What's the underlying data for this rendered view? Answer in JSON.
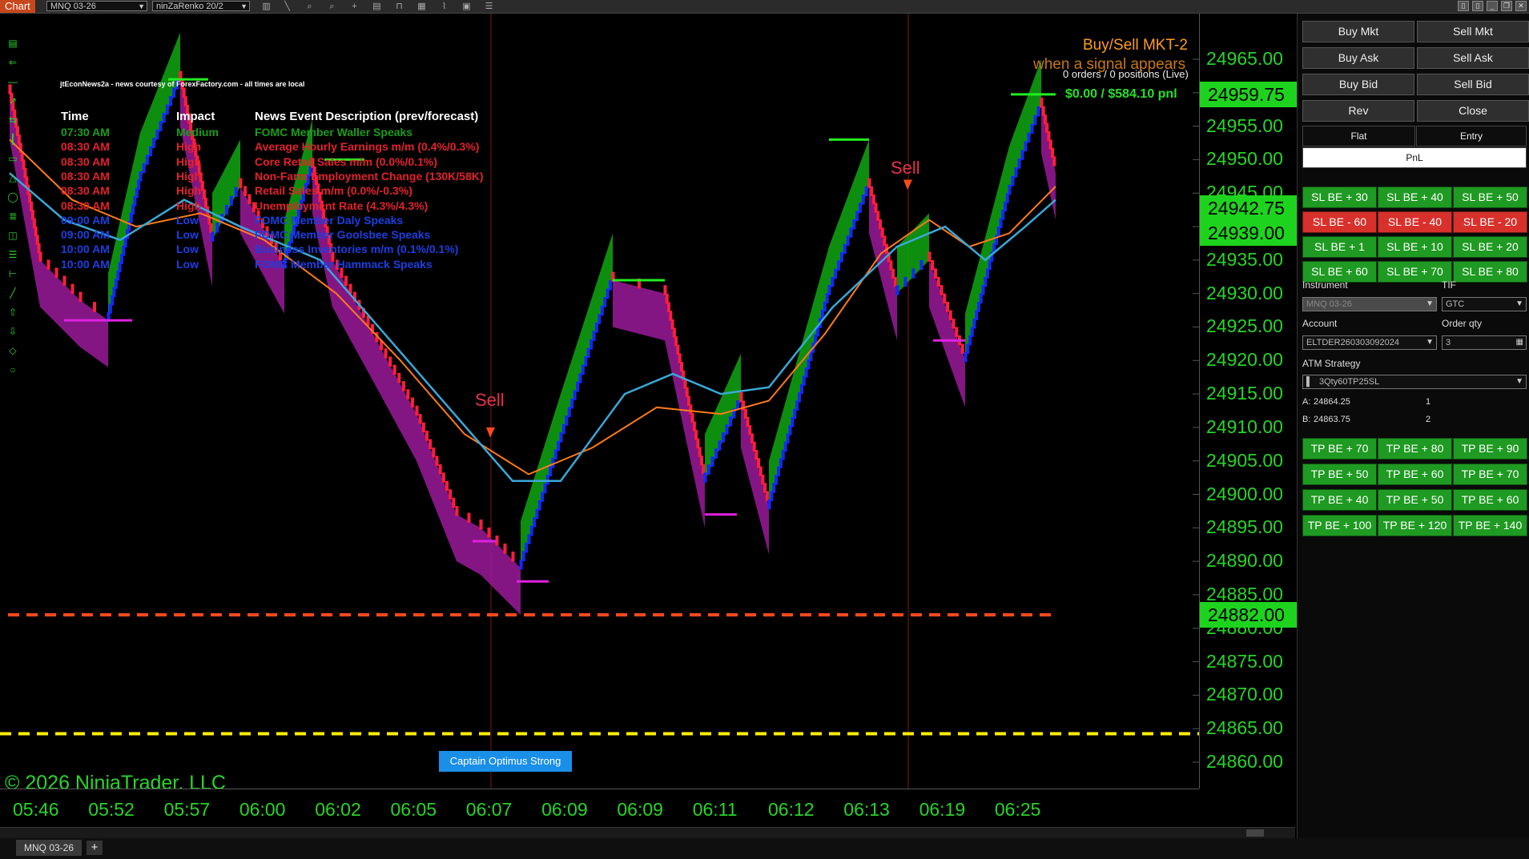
{
  "toolbar": {
    "app_label": "Chart",
    "instrument": "MNQ 03-26",
    "bar_type": "ninZaRenko 20/2"
  },
  "chart": {
    "news": {
      "source": "jtEconNews2a - news courtesy of ForexFactory.com - all times are local",
      "headers": {
        "time": "Time",
        "impact": "Impact",
        "description": "News Event Description (prev/forecast)"
      },
      "rows": [
        {
          "time": "07:30 AM",
          "impact": "Medium",
          "description": "FOMC Member Waller Speaks",
          "color": "#1b9d1b"
        },
        {
          "time": "08:30 AM",
          "impact": "High",
          "description": "Average Hourly Earnings m/m (0.4%/0.3%)",
          "color": "#e3222a"
        },
        {
          "time": "08:30 AM",
          "impact": "High",
          "description": "Core Retail Sales m/m (0.0%/0.1%)",
          "color": "#e3222a"
        },
        {
          "time": "08:30 AM",
          "impact": "High",
          "description": "Non-Farm Employment Change (130K/58K)",
          "color": "#e3222a"
        },
        {
          "time": "08:30 AM",
          "impact": "High",
          "description": "Retail Sales m/m (0.0%/-0.3%)",
          "color": "#e3222a"
        },
        {
          "time": "08:30 AM",
          "impact": "High",
          "description": "Unemployment Rate (4.3%/4.3%)",
          "color": "#e3222a"
        },
        {
          "time": "09:00 AM",
          "impact": "Low",
          "description": "FOMC Member Daly Speaks",
          "color": "#1c3fe0"
        },
        {
          "time": "09:00 AM",
          "impact": "Low",
          "description": "FOMC Member Goolsbee Speaks",
          "color": "#1c3fe0"
        },
        {
          "time": "10:00 AM",
          "impact": "Low",
          "description": "Business Inventories m/m (0.1%/0.1%)",
          "color": "#1c3fe0"
        },
        {
          "time": "10:00 AM",
          "impact": "Low",
          "description": "FOMC Member Hammack Speaks",
          "color": "#1c3fe0"
        }
      ]
    },
    "buy_sell": {
      "title": "Buy/Sell MKT-2",
      "subtitle": "when a signal appears",
      "orders": "0 orders / 0 positions (Live)",
      "pnl": "$0.00 / $584.10 pnl"
    },
    "sell_labels": [
      "Sell",
      "Sell"
    ],
    "captain_button": "Captain Optimus Strong",
    "copyright": "© 2026 NinjaTrader, LLC",
    "price_ticks": [
      "24965.00",
      "24960.00",
      "24955.00",
      "24950.00",
      "24945.00",
      "24940.00",
      "24935.00",
      "24930.00",
      "24925.00",
      "24920.00",
      "24915.00",
      "24910.00",
      "24905.00",
      "24900.00",
      "24895.00",
      "24890.00",
      "24885.00",
      "24880.00",
      "24875.00",
      "24870.00",
      "24865.00",
      "24860.00"
    ],
    "price_tags": [
      {
        "label": "24959.75",
        "price": 24959.75
      },
      {
        "label": "24942.75",
        "price": 24942.75
      },
      {
        "label": "24939.00",
        "price": 24939.0
      },
      {
        "label": "24882.00",
        "price": 24882.0
      }
    ],
    "time_ticks": [
      "05:46",
      "05:52",
      "05:57",
      "06:00",
      "06:02",
      "06:05",
      "06:07",
      "06:09",
      "06:09",
      "06:11",
      "06:12",
      "06:13",
      "06:19",
      "06:25"
    ],
    "colors": {
      "axis_green": "#27d427",
      "up_brick": "#1428ff",
      "down_brick": "#ff1e3c",
      "channel_green": "#11a711",
      "channel_purple": "#9a1a9a",
      "orange_line": "#ff4a1a",
      "yellow_line": "#ffee00"
    },
    "levels": {
      "orange_dashed": 24882.0,
      "yellow_dashed": 24864.25
    }
  },
  "bottom": {
    "tab": "MNQ 03-26",
    "add_tab": "+"
  },
  "panel": {
    "order_buttons": [
      [
        "Buy Mkt",
        "Sell Mkt"
      ],
      [
        "Buy Ask",
        "Sell Ask"
      ],
      [
        "Buy Bid",
        "Sell Bid"
      ],
      [
        "Rev",
        "Close"
      ]
    ],
    "tabs": [
      "Flat",
      "Entry"
    ],
    "pnl_tab": "PnL",
    "sl_rows": [
      [
        {
          "label": "SL BE + 30",
          "kind": "green"
        },
        {
          "label": "SL BE + 40",
          "kind": "green"
        },
        {
          "label": "SL BE + 50",
          "kind": "green"
        }
      ],
      [
        {
          "label": "SL BE - 60",
          "kind": "red"
        },
        {
          "label": "SL BE - 40",
          "kind": "red"
        },
        {
          "label": "SL BE - 20",
          "kind": "red"
        }
      ],
      [
        {
          "label": "SL BE + 1",
          "kind": "green"
        },
        {
          "label": "SL BE + 10",
          "kind": "green"
        },
        {
          "label": "SL BE + 20",
          "kind": "green"
        }
      ],
      [
        {
          "label": "SL BE + 60",
          "kind": "green"
        },
        {
          "label": "SL BE + 70",
          "kind": "green"
        },
        {
          "label": "SL BE + 80",
          "kind": "green"
        }
      ]
    ],
    "instrument_label": "Instrument",
    "instrument_value": "MNQ 03-26",
    "tif_label": "TIF",
    "tif_value": "GTC",
    "account_label": "Account",
    "account_value": "ELTDER260303092024",
    "qty_label": "Order qty",
    "qty_value": "3",
    "atm_label": "ATM Strategy",
    "atm_value": "3Qty60TP25SL",
    "ask_line": {
      "label": "A:",
      "price": "24864.25",
      "size": "1"
    },
    "bid_line": {
      "label": "B:",
      "price": "24863.75",
      "size": "2"
    },
    "tp_rows": [
      [
        "TP BE + 70",
        "TP BE + 80",
        "TP BE + 90"
      ],
      [
        "TP BE + 50",
        "TP BE + 60",
        "TP BE + 70"
      ],
      [
        "TP BE + 40",
        "TP BE + 50",
        "TP BE + 60"
      ],
      [
        "TP BE + 100",
        "TP BE + 120",
        "TP BE + 140"
      ]
    ]
  }
}
